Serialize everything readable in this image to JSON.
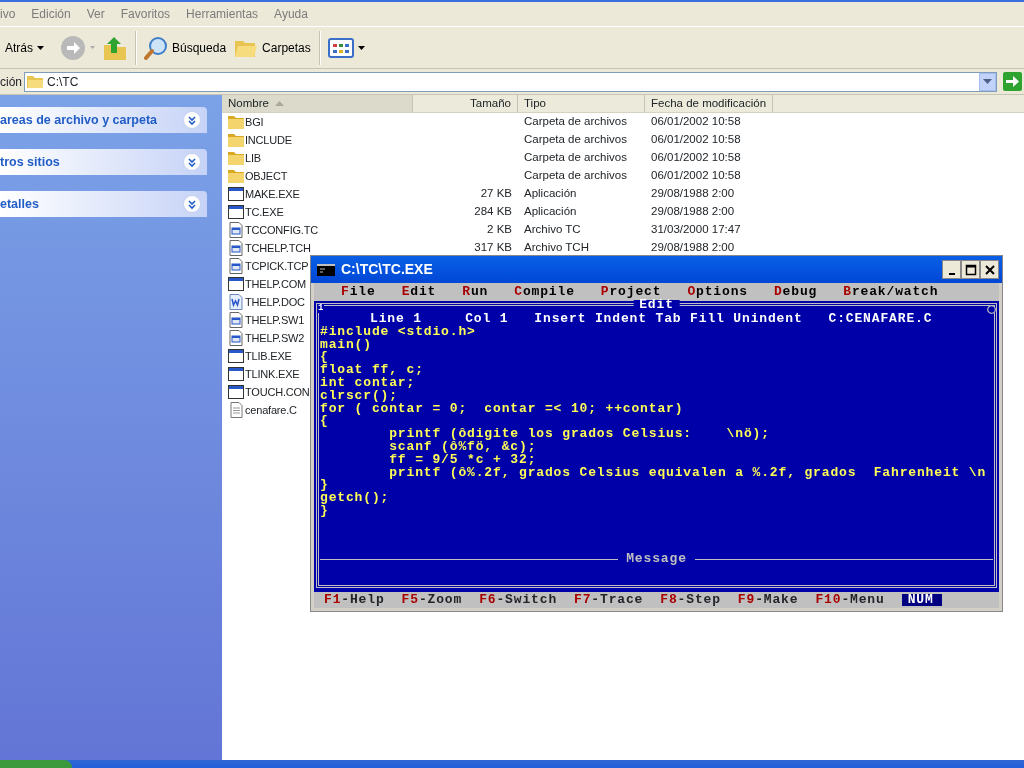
{
  "explorer": {
    "menu": [
      "ivo",
      "Edición",
      "Ver",
      "Favoritos",
      "Herramientas",
      "Ayuda"
    ],
    "toolbar": [
      {
        "kind": "back",
        "label": "Atrás"
      },
      {
        "kind": "forward",
        "disabled": true
      },
      {
        "kind": "up"
      },
      {
        "kind": "search",
        "label": "Búsqueda"
      },
      {
        "kind": "folders",
        "label": "Carpetas"
      },
      {
        "kind": "views"
      }
    ],
    "address": {
      "label": "ción",
      "path": "C:\\TC"
    },
    "task_panels": [
      {
        "title": "areas de archivo y carpeta",
        "expanded": false
      },
      {
        "title": "tros sitios",
        "expanded": false
      },
      {
        "title": "etalles",
        "expanded": false
      }
    ],
    "columns": [
      {
        "label": "Nombre",
        "sorted": true
      },
      {
        "label": "Tamaño",
        "sorted": false
      },
      {
        "label": "Tipo",
        "sorted": false
      },
      {
        "label": "Fecha de modificación",
        "sorted": false
      }
    ],
    "files": [
      {
        "name": "BGI",
        "kind": "folder",
        "type": "Carpeta de archivos",
        "modified": "06/01/2002 10:58"
      },
      {
        "name": "INCLUDE",
        "kind": "folder",
        "type": "Carpeta de archivos",
        "modified": "06/01/2002 10:58"
      },
      {
        "name": "LIB",
        "kind": "folder",
        "type": "Carpeta de archivos",
        "modified": "06/01/2002 10:58"
      },
      {
        "name": "OBJECT",
        "kind": "folder",
        "type": "Carpeta de archivos",
        "modified": "06/01/2002 10:58"
      },
      {
        "name": "MAKE.EXE",
        "kind": "app",
        "size": "27 KB",
        "type": "Aplicación",
        "modified": "29/08/1988 2:00"
      },
      {
        "name": "TC.EXE",
        "kind": "app",
        "size": "284 KB",
        "type": "Aplicación",
        "modified": "29/08/1988 2:00"
      },
      {
        "name": "TCCONFIG.TC",
        "kind": "config",
        "size": "2 KB",
        "type": "Archivo TC",
        "modified": "31/03/2000 17:47"
      },
      {
        "name": "TCHELP.TCH",
        "kind": "config",
        "size": "317 KB",
        "type": "Archivo TCH",
        "modified": "29/08/1988 2:00"
      },
      {
        "name": "TCPICK.TCP",
        "kind": "config"
      },
      {
        "name": "THELP.COM",
        "kind": "app"
      },
      {
        "name": "THELP.DOC",
        "kind": "doc"
      },
      {
        "name": "THELP.SW1",
        "kind": "config"
      },
      {
        "name": "THELP.SW2",
        "kind": "config"
      },
      {
        "name": "TLIB.EXE",
        "kind": "app"
      },
      {
        "name": "TLINK.EXE",
        "kind": "app"
      },
      {
        "name": "TOUCH.CON",
        "kind": "app"
      },
      {
        "name": "cenafare.C",
        "kind": "text"
      }
    ]
  },
  "console": {
    "title": "C:\\TC\\TC.EXE",
    "menu": [
      {
        "hotkey": "F",
        "rest": "ile"
      },
      {
        "hotkey": "E",
        "rest": "dit"
      },
      {
        "hotkey": "R",
        "rest": "un"
      },
      {
        "hotkey": "C",
        "rest": "ompile"
      },
      {
        "hotkey": "P",
        "rest": "roject"
      },
      {
        "hotkey": "O",
        "rest": "ptions"
      },
      {
        "hotkey": "D",
        "rest": "ebug"
      },
      {
        "hotkey": "B",
        "rest": "reak/watch"
      }
    ],
    "window_number": "1",
    "edit_title": "Edit",
    "status": "Line 1     Col 1   Insert Indent Tab Fill Unindent   C:CENAFARE.C",
    "code": [
      "#include <stdio.h>",
      "main()",
      "{",
      "float ff, c;",
      "int contar;",
      "clrscr();",
      "for ( contar = 0;  contar =< 10; ++contar)",
      "{",
      "        printf (ôdigite los grados Celsius:    \\nö);",
      "        scanf (ô%fö, &c);",
      "        ff = 9/5 *c + 32;",
      "        printf (ô%.2f, grados Celsius equivalen a %.2f, grados  Fahrenheit \\n",
      "}",
      "getch();",
      "}"
    ],
    "message_title": "Message",
    "keys": [
      {
        "key": "F1",
        "action": "-Help"
      },
      {
        "key": "F5",
        "action": "-Zoom"
      },
      {
        "key": "F6",
        "action": "-Switch"
      },
      {
        "key": "F7",
        "action": "-Trace"
      },
      {
        "key": "F8",
        "action": "-Step"
      },
      {
        "key": "F9",
        "action": "-Make"
      },
      {
        "key": "F10",
        "action": "-Menu"
      }
    ],
    "indicator": "NUM"
  }
}
